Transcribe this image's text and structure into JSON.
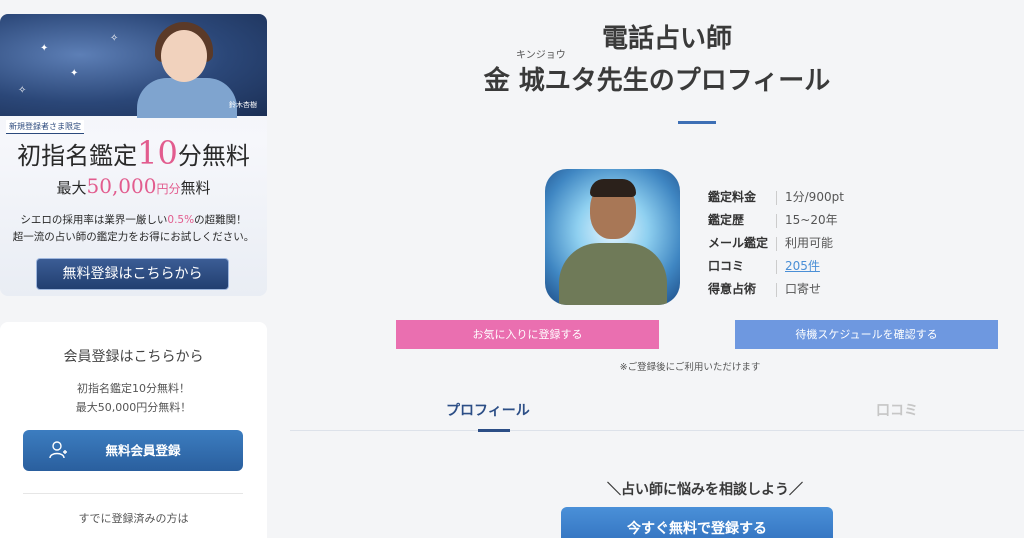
{
  "banner": {
    "credit": "鈴木杏樹",
    "tag": "新規登録者さま限定",
    "line1_a": "初指名鑑定",
    "line1_num": "10",
    "line1_b": "分無料",
    "line2_a": "最大",
    "line2_num": "50,000",
    "line2_unit": "円分",
    "line2_b": "無料",
    "line3_a": "シエロの採用率は業界一厳しい",
    "line3_num": "0.5",
    "line3_unit": "%",
    "line3_b": "の超難関！",
    "line4": "超一流の占い師の鑑定力をお得にお試しください。",
    "button_label": "無料登録はこちらから"
  },
  "member": {
    "title": "会員登録はこちらから",
    "sub1": "初指名鑑定10分無料！",
    "sub2": "最大50,000円分無料！",
    "button_label": "無料会員登録",
    "footer": "すでに登録済みの方は"
  },
  "profile": {
    "title_line1": "電話占い師",
    "ruby": "キンジョウ",
    "title_line2": "金 城ユタ先生のプロフィール",
    "info": [
      {
        "key": "鑑定料金",
        "value": "1分/900pt"
      },
      {
        "key": "鑑定歴",
        "value": "15~20年"
      },
      {
        "key": "メール鑑定",
        "value": "利用可能"
      },
      {
        "key": "口コミ",
        "value": "205件"
      },
      {
        "key": "得意占術",
        "value": "口寄せ"
      }
    ],
    "favorite_button": "お気に入りに登録する",
    "schedule_button": "待機スケジュールを確認する",
    "note": "※ご登録後にご利用いただけます"
  },
  "tabs": {
    "profile": "プロフィール",
    "reviews": "口コミ",
    "active": "profile"
  },
  "cta": {
    "heading": "＼占い師に悩みを相談しよう／",
    "button_label": "今すぐ無料で登録する"
  },
  "colors": {
    "accent_pink": "#ea6fb0",
    "accent_blue": "#6e98e0",
    "nav_blue": "#2c4e86",
    "cta_blue": "#2f6dbb"
  }
}
